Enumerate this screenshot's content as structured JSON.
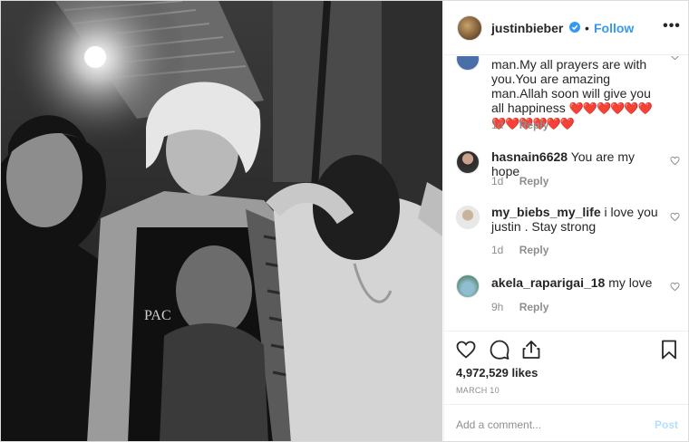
{
  "post": {
    "author": "justinbieber",
    "verified": true,
    "separator": "•",
    "follow_label": "Follow",
    "more_label": "•••",
    "likes": "4,972,529 likes",
    "date": "MARCH 10"
  },
  "comments": [
    {
      "username": "",
      "text": "man.My all prayers are with you.You are amazing man.Allah soon will give you all happiness",
      "hearts": "❤️❤️❤️❤️❤️❤️❤️❤️❤️❤️❤️❤️",
      "time": "1d",
      "reply": "Reply"
    },
    {
      "username": "hasnain6628",
      "text": "You are my hope",
      "time": "1d",
      "reply": "Reply"
    },
    {
      "username": "my_biebs_my_life",
      "text": "i love you justin . Stay strong",
      "time": "1d",
      "reply": "Reply"
    },
    {
      "username": "akela_raparigai_18",
      "text": "my love",
      "time": "9h",
      "reply": "Reply"
    }
  ],
  "composer": {
    "placeholder": "Add a comment...",
    "post_label": "Post"
  },
  "icons": {
    "like": "heart-icon",
    "comment": "comment-icon",
    "share": "share-icon",
    "save": "bookmark-icon"
  },
  "colors": {
    "link": "#3897f0",
    "post_disabled": "#b2dffc",
    "meta": "#8e8e8e",
    "heart": "#e0245e"
  }
}
